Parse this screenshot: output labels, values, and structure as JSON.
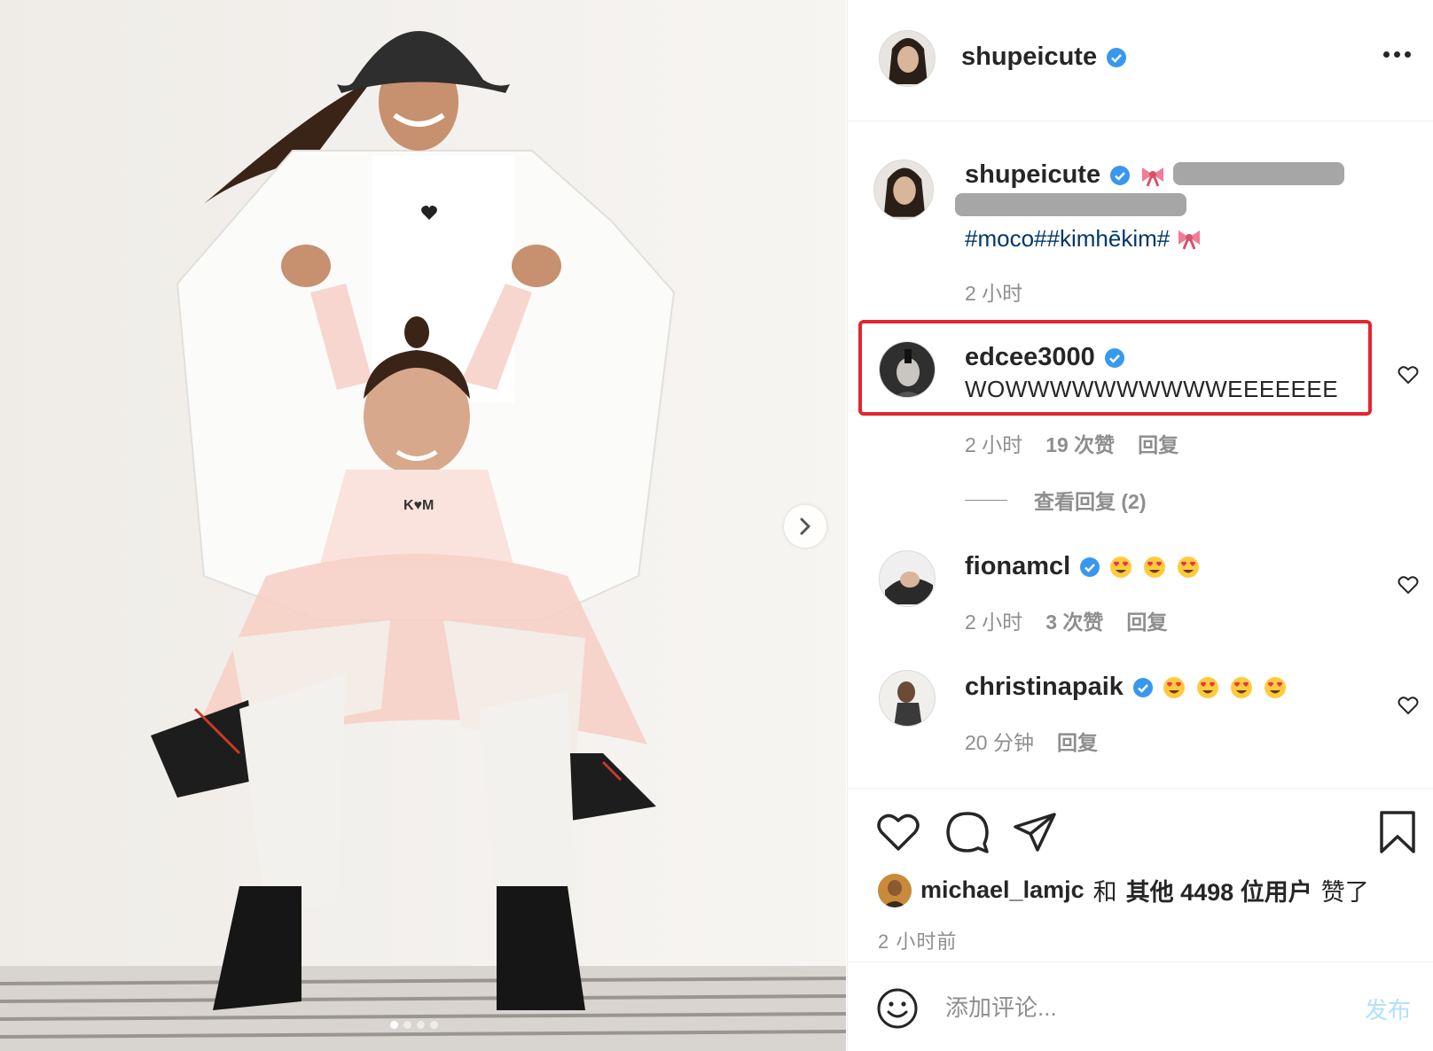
{
  "post": {
    "author": "shupeicute",
    "carousel_slides": 4,
    "carousel_active": 1
  },
  "header": {
    "username": "shupeicute",
    "more_icon": "more-horizontal-icon"
  },
  "caption": {
    "username": "shupeicute",
    "hashtags": "#moco##kimhēkim#",
    "time": "2 小时"
  },
  "comments": [
    {
      "username": "edcee3000",
      "text": "WOWWWWWWWWWWEEEEEEE",
      "time": "2 小时",
      "likes": "19 次赞",
      "reply": "回复",
      "view_replies": "查看回复 (2)"
    },
    {
      "username": "fionamcl",
      "emoji_count": 3,
      "time": "2 小时",
      "likes": "3 次赞",
      "reply": "回复"
    },
    {
      "username": "christinapaik",
      "emoji_count": 4,
      "time": "20 分钟",
      "reply": "回复"
    }
  ],
  "likes_line": {
    "user": "michael_lamjc",
    "and": "和",
    "others": "其他 4498 位用户",
    "suffix": "赞了"
  },
  "posted_time": "2 小时前",
  "composer": {
    "placeholder": "添加评论...",
    "post_label": "发布"
  },
  "colors": {
    "accent_link": "#00376b",
    "verified": "#3897f0",
    "highlight_box": "#e3252e",
    "post_disabled": "#b2dffc"
  }
}
